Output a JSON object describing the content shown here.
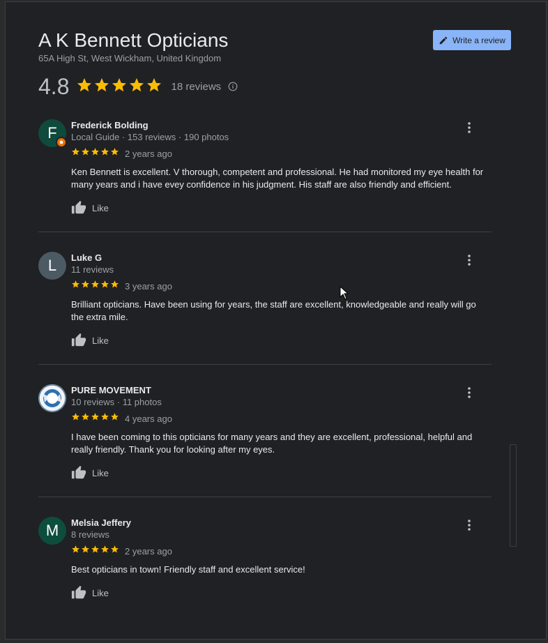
{
  "header": {
    "title": "A K Bennett Opticians",
    "address": "65A High St, West Wickham, United Kingdom",
    "write_review_label": "Write a review"
  },
  "summary": {
    "rating": "4.8",
    "stars": 5,
    "review_count": "18 reviews"
  },
  "colors": {
    "star": "#fbbc04",
    "accent_button": "#8ab4f8",
    "local_guide_badge": "#e8710a"
  },
  "reviews": [
    {
      "name": "Frederick Bolding",
      "avatar_letter": "F",
      "avatar_color": "#0f4a3c",
      "local_guide": true,
      "meta": "Local Guide · 153 reviews · 190 photos",
      "rating": 5,
      "date": "2 years ago",
      "text": "Ken Bennett is excellent. V thorough, competent and professional. He had monitored my eye health for many years and i have evey confidence in his judgment. His staff are also friendly and efficient.",
      "like_label": "Like"
    },
    {
      "name": "Luke G",
      "avatar_letter": "L",
      "avatar_color": "#4b5a63",
      "local_guide": false,
      "meta": "11 reviews",
      "rating": 5,
      "date": "3 years ago",
      "text": "Brilliant opticians. Have been using for years, the staff are excellent, knowledgeable and really will go the extra mile.",
      "like_label": "Like"
    },
    {
      "name": "PURE MOVEMENT",
      "avatar_letter": "",
      "avatar_color": "#cfe3f5",
      "local_guide": false,
      "meta": "10 reviews · 11 photos",
      "rating": 5,
      "date": "4 years ago",
      "text": "I have been coming to this opticians for many years and they are excellent, professional, helpful and really friendly.  Thank you for looking after my eyes.",
      "like_label": "Like"
    },
    {
      "name": "Melsia Jeffery",
      "avatar_letter": "M",
      "avatar_color": "#0d4d3d",
      "local_guide": false,
      "meta": "8 reviews",
      "rating": 5,
      "date": "2 years ago",
      "text": "Best opticians in town! Friendly staff and excellent service!",
      "like_label": "Like"
    }
  ]
}
